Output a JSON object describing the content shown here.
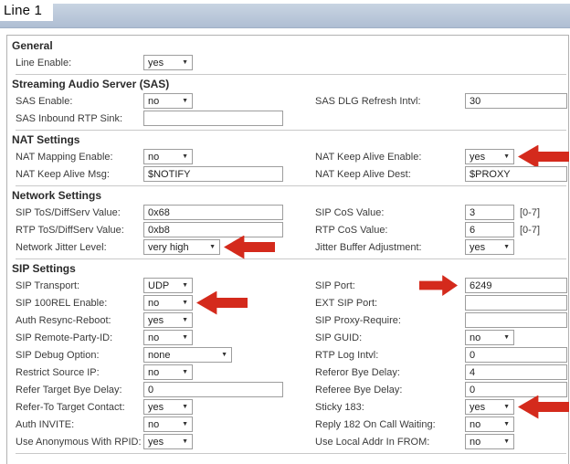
{
  "title_bar": {
    "tab_label": "Line 1"
  },
  "colors": {
    "title_bar_blue": "#b7c4d8",
    "arrow_red": "#d42a1c"
  },
  "sections": [
    {
      "heading": "General",
      "rows": [
        {
          "left": {
            "label": "Line Enable:",
            "control": "select",
            "value": "yes"
          },
          "right": null
        }
      ]
    },
    {
      "heading": "Streaming Audio Server (SAS)",
      "rows": [
        {
          "left": {
            "label": "SAS Enable:",
            "control": "select",
            "value": "no"
          },
          "right": {
            "label": "SAS DLG Refresh Intvl:",
            "control": "input",
            "value": "30",
            "size": "wide"
          }
        },
        {
          "left": {
            "label": "SAS Inbound RTP Sink:",
            "control": "input",
            "value": "",
            "size": "wide"
          },
          "right": null
        }
      ]
    },
    {
      "heading": "NAT Settings",
      "rows": [
        {
          "left": {
            "label": "NAT Mapping Enable:",
            "control": "select",
            "value": "no"
          },
          "right": {
            "label": "NAT Keep Alive Enable:",
            "control": "select",
            "value": "yes",
            "arrow": "left"
          }
        },
        {
          "left": {
            "label": "NAT Keep Alive Msg:",
            "control": "input",
            "value": "$NOTIFY",
            "size": "wide"
          },
          "right": {
            "label": "NAT Keep Alive Dest:",
            "control": "input",
            "value": "$PROXY",
            "size": "wide"
          }
        }
      ]
    },
    {
      "heading": "Network Settings",
      "rows": [
        {
          "left": {
            "label": "SIP ToS/DiffServ Value:",
            "control": "input",
            "value": "0x68",
            "size": "wide"
          },
          "right": {
            "label": "SIP CoS Value:",
            "control": "input",
            "value": "3",
            "size": "narrow",
            "suffix": "[0-7]"
          }
        },
        {
          "left": {
            "label": "RTP ToS/DiffServ Value:",
            "control": "input",
            "value": "0xb8",
            "size": "wide"
          },
          "right": {
            "label": "RTP CoS Value:",
            "control": "input",
            "value": "6",
            "size": "narrow",
            "suffix": "[0-7]"
          }
        },
        {
          "left": {
            "label": "Network Jitter Level:",
            "control": "select",
            "value": "very high",
            "size": "medium",
            "arrow": "left"
          },
          "right": {
            "label": "Jitter Buffer Adjustment:",
            "control": "select",
            "value": "yes"
          }
        }
      ]
    },
    {
      "heading": "SIP Settings",
      "rows": [
        {
          "left": {
            "label": "SIP Transport:",
            "control": "select",
            "value": "UDP"
          },
          "right": {
            "label": "SIP Port:",
            "control": "input",
            "value": "6249",
            "size": "wide",
            "arrow": "right"
          }
        },
        {
          "left": {
            "label": "SIP 100REL Enable:",
            "control": "select",
            "value": "no",
            "arrow": "left"
          },
          "right": {
            "label": "EXT SIP Port:",
            "control": "input",
            "value": "",
            "size": "wide"
          }
        },
        {
          "left": {
            "label": "Auth Resync-Reboot:",
            "control": "select",
            "value": "yes"
          },
          "right": {
            "label": "SIP Proxy-Require:",
            "control": "input",
            "value": "",
            "size": "wide"
          }
        },
        {
          "left": {
            "label": "SIP Remote-Party-ID:",
            "control": "select",
            "value": "no"
          },
          "right": {
            "label": "SIP GUID:",
            "control": "select",
            "value": "no"
          }
        },
        {
          "left": {
            "label": "SIP Debug Option:",
            "control": "select",
            "value": "none",
            "size": "xwide"
          },
          "right": {
            "label": "RTP Log Intvl:",
            "control": "input",
            "value": "0",
            "size": "wide"
          }
        },
        {
          "left": {
            "label": "Restrict Source IP:",
            "control": "select",
            "value": "no"
          },
          "right": {
            "label": "Referor Bye Delay:",
            "control": "input",
            "value": "4",
            "size": "wide"
          }
        },
        {
          "left": {
            "label": "Refer Target Bye Delay:",
            "control": "input",
            "value": "0",
            "size": "wide"
          },
          "right": {
            "label": "Referee Bye Delay:",
            "control": "input",
            "value": "0",
            "size": "wide"
          }
        },
        {
          "left": {
            "label": "Refer-To Target Contact:",
            "control": "select",
            "value": "yes"
          },
          "right": {
            "label": "Sticky 183:",
            "control": "select",
            "value": "yes",
            "arrow": "left"
          }
        },
        {
          "left": {
            "label": "Auth INVITE:",
            "control": "select",
            "value": "no"
          },
          "right": {
            "label": "Reply 182 On Call Waiting:",
            "control": "select",
            "value": "no"
          }
        },
        {
          "left": {
            "label": "Use Anonymous With RPID:",
            "control": "select",
            "value": "yes"
          },
          "right": {
            "label": "Use Local Addr In FROM:",
            "control": "select",
            "value": "no"
          }
        }
      ]
    }
  ]
}
